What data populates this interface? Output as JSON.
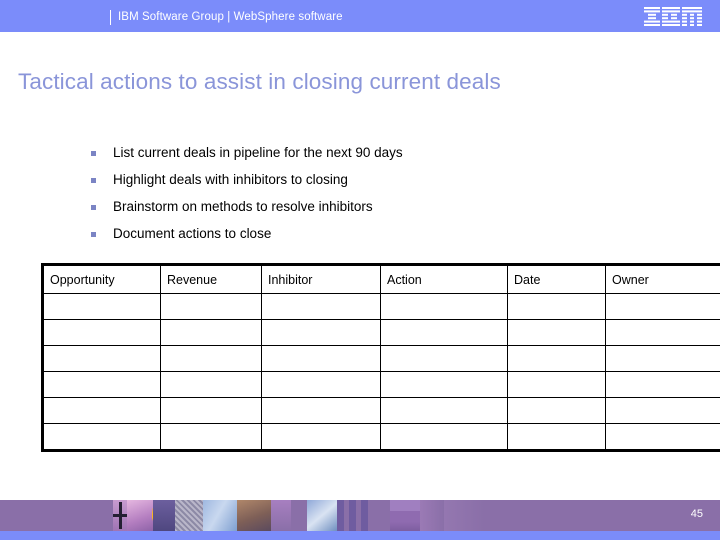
{
  "header": {
    "brand_text": "IBM Software Group | WebSphere software",
    "logo_icon": "ibm-logo-icon",
    "band_color": "#7b8cfa",
    "text_color": "#ffffff"
  },
  "title": {
    "text": "Tactical actions to assist in closing current deals",
    "color": "#8a95d9"
  },
  "bullets": {
    "marker_icon": "square-bullet-icon",
    "marker_color": "#7b84c4",
    "items": [
      "List current deals in pipeline for the next 90 days",
      "Highlight deals with inhibitors to closing",
      "Brainstorm on methods to resolve inhibitors",
      "Document actions to close"
    ]
  },
  "table": {
    "columns": [
      "Opportunity",
      "Revenue",
      "Inhibitor",
      "Action",
      "Date",
      "Owner"
    ],
    "rows": [
      [
        "",
        "",
        "",
        "",
        "",
        ""
      ],
      [
        "",
        "",
        "",
        "",
        "",
        ""
      ],
      [
        "",
        "",
        "",
        "",
        "",
        ""
      ],
      [
        "",
        "",
        "",
        "",
        "",
        ""
      ],
      [
        "",
        "",
        "",
        "",
        "",
        ""
      ],
      [
        "",
        "",
        "",
        "",
        "",
        ""
      ]
    ],
    "border_color": "#000000"
  },
  "footer": {
    "page_number": "45",
    "band_color": "#8a6fa8",
    "accent_bar_color": "#7b8cfa",
    "collage_icon": "photo-collage-strip",
    "cross_icon": "cross-icon",
    "hand_icon": "hand-icon"
  }
}
